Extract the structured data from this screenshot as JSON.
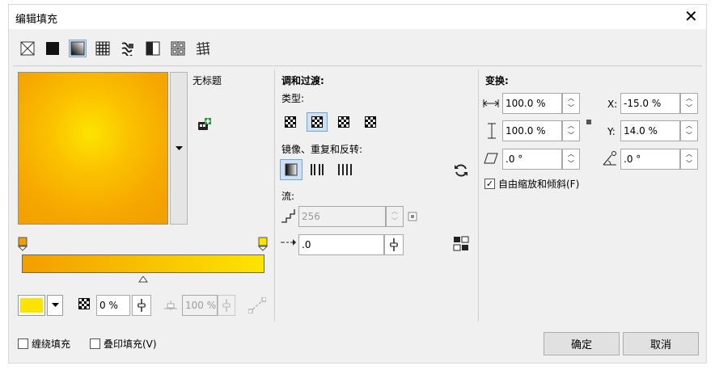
{
  "window": {
    "title": "编辑填充",
    "close": "✕"
  },
  "fill_types": [
    "no-fill",
    "uniform-fill",
    "fountain-fill",
    "vector-pattern-fill",
    "bitmap-pattern-fill",
    "two-color-pattern-fill",
    "texture-fill",
    "postscript-fill"
  ],
  "preset": {
    "name": "无标题"
  },
  "blend": {
    "heading": "调和过渡:",
    "type_label": "类型:",
    "mirror_label": "镜像、重复和反转:",
    "flow_label": "流:",
    "steps_value": "256",
    "acceleration_value": ".0"
  },
  "transform": {
    "heading": "变换:",
    "width_value": "100.0 %",
    "height_value": "100.0 %",
    "skew_value": ".0 °",
    "x_label": "X:",
    "x_value": "-15.0 %",
    "y_label": "Y:",
    "y_value": "14.0 %",
    "rotate_value": ".0 °",
    "free_scale_label": "自由缩放和倾斜(F)",
    "free_scale_checked": true
  },
  "gradient": {
    "start_color": "#f29e00",
    "end_color": "#fde400",
    "node_color": "#fde400",
    "opacity_value": "0 %",
    "position_value": "100 %"
  },
  "footer": {
    "wrap_label": "缠绕填充",
    "overprint_label": "叠印填充(V)",
    "ok_label": "确定",
    "cancel_label": "取消"
  }
}
